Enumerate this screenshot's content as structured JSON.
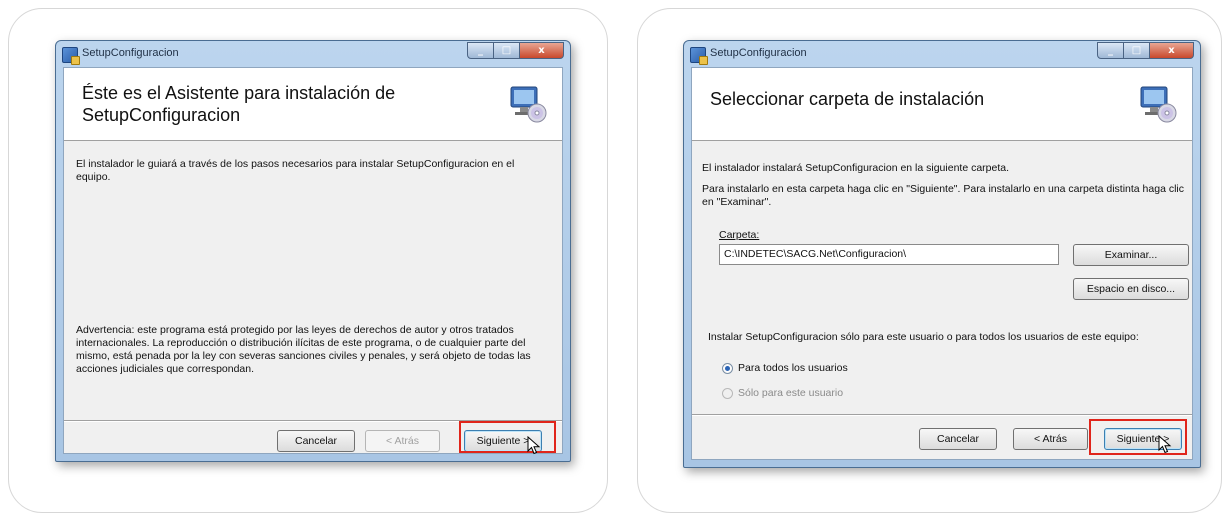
{
  "left_window": {
    "title": "SetupConfiguracion",
    "heading": "Éste es el Asistente para instalación de SetupConfiguracion",
    "intro": "El instalador le guiará a través de los pasos necesarios para instalar SetupConfiguracion en el equipo.",
    "warning": "Advertencia: este programa está protegido por las leyes de derechos de autor y otros tratados internacionales. La reproducción o distribución ilícitas de este programa, o de cualquier parte del mismo, está penada por la ley con severas sanciones civiles y penales, y será objeto de todas las acciones judiciales que correspondan.",
    "buttons": {
      "cancel": "Cancelar",
      "back": "< Atrás",
      "next": "Siguiente >"
    }
  },
  "right_window": {
    "title": "SetupConfiguracion",
    "heading": "Seleccionar carpeta de instalación",
    "line1": "El instalador instalará SetupConfiguracion en la siguiente carpeta.",
    "line2": "Para instalarlo en esta carpeta haga clic en \"Siguiente\". Para instalarlo en una carpeta distinta haga clic en \"Examinar\".",
    "folder_label": "Carpeta:",
    "folder_value": "C:\\INDETEC\\SACG.Net\\Configuracion\\",
    "browse_button": "Examinar...",
    "disk_space_button": "Espacio en disco...",
    "install_for_text": "Instalar SetupConfiguracion sólo para este usuario o para todos los usuarios de este equipo:",
    "options": [
      {
        "label": "Para todos los usuarios",
        "selected": true
      },
      {
        "label": "Sólo para este usuario",
        "selected": false
      }
    ],
    "buttons": {
      "cancel": "Cancelar",
      "back": "< Atrás",
      "next": "Siguiente >"
    }
  },
  "colors": {
    "highlight": "#e0251b",
    "title_bar": "#bcd5ee",
    "close_button": "#c9482c"
  },
  "icons": [
    "installer-icon",
    "setup-computer-icon",
    "mouse-cursor-icon"
  ]
}
